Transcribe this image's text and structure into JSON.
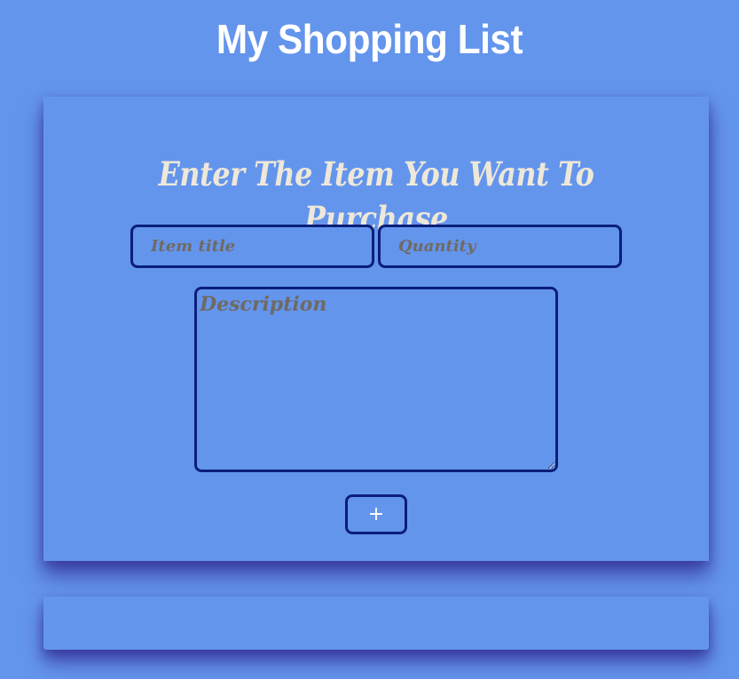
{
  "header": {
    "title": "My Shopping List"
  },
  "form": {
    "heading": "Enter The Item You Want To Purchase",
    "item_title": {
      "placeholder": "Item title",
      "value": ""
    },
    "quantity": {
      "placeholder": "Quantity",
      "value": ""
    },
    "description": {
      "placeholder": "Description",
      "value": ""
    },
    "add_button_label": "+"
  },
  "colors": {
    "background": "#6495ed",
    "heading_text": "#eee8d8",
    "field_border": "#0a1f7a",
    "placeholder_text": "#6f6a62",
    "title_text": "#ffffff"
  }
}
